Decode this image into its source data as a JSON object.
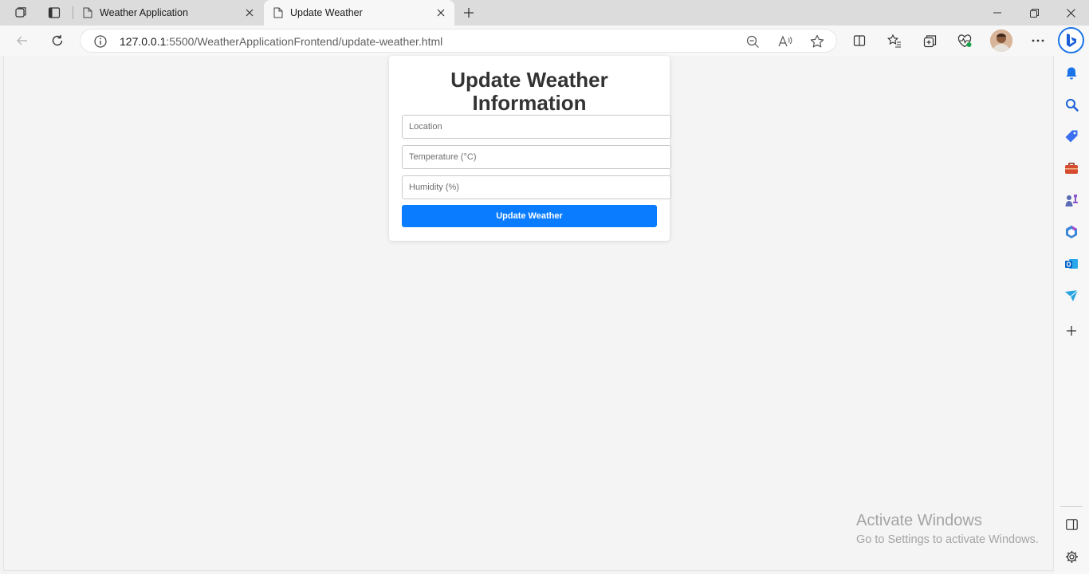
{
  "browser": {
    "tabs": [
      {
        "title": "Weather Application",
        "active": false
      },
      {
        "title": "Update Weather",
        "active": true
      }
    ],
    "address": {
      "host": "127.0.0.1",
      "rest": ":5500/WeatherApplicationFrontend/update-weather.html"
    }
  },
  "page": {
    "heading": "Update Weather Information",
    "fields": {
      "location_placeholder": "Location",
      "temperature_placeholder": "Temperature (°C)",
      "humidity_placeholder": "Humidity (%)"
    },
    "submit_label": "Update Weather"
  },
  "watermark": {
    "line1": "Activate Windows",
    "line2": "Go to Settings to activate Windows."
  },
  "colors": {
    "accent": "#0a7cff",
    "page_bg": "#f4f4f4",
    "heading": "#333333"
  },
  "icons": {
    "sidebar": [
      "bell-icon",
      "search-icon",
      "tag-icon",
      "toolbox-icon",
      "games-icon",
      "office-icon",
      "outlook-icon",
      "drop-icon",
      "plus-icon",
      "split-panel-icon",
      "gear-icon"
    ]
  }
}
